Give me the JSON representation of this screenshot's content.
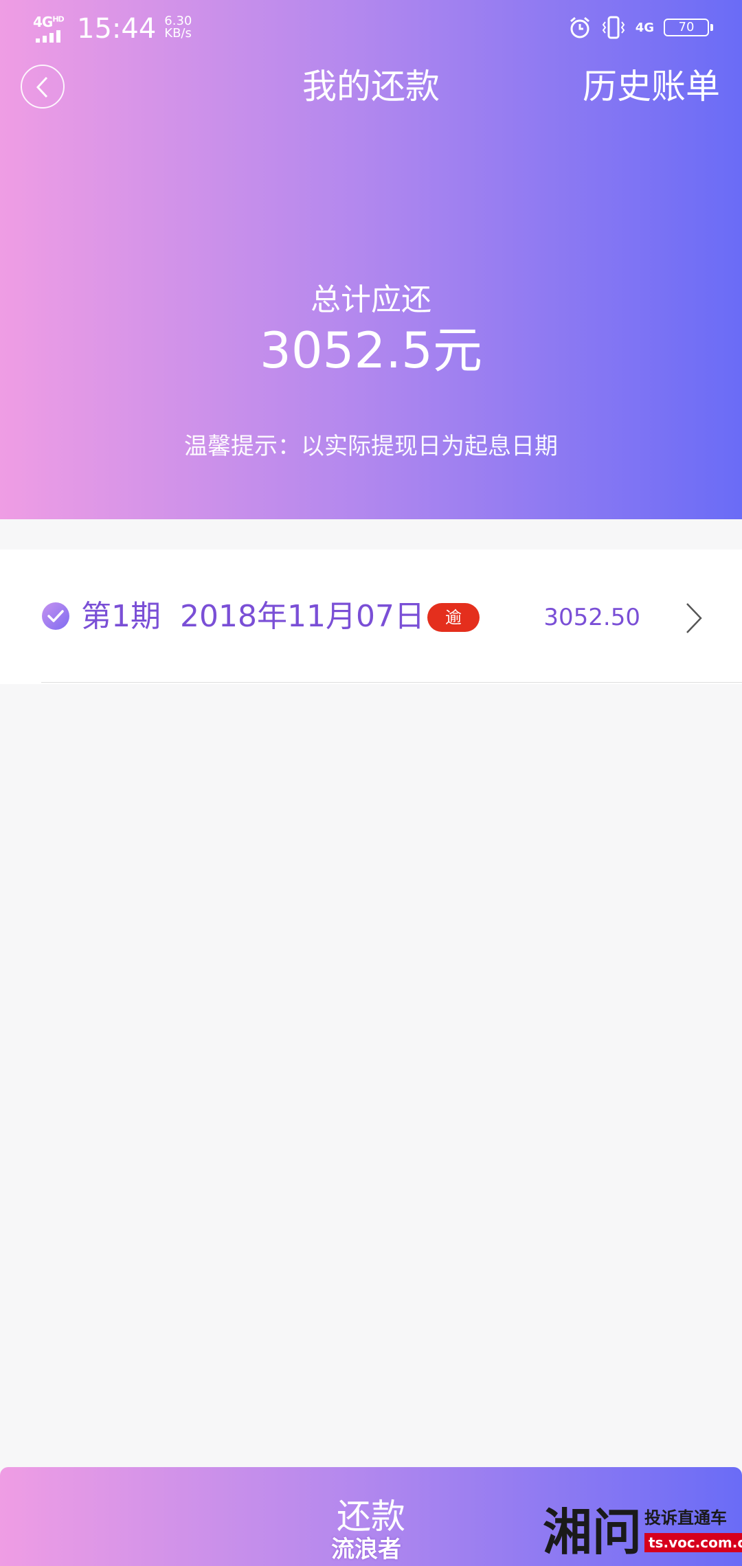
{
  "status_bar": {
    "network": "4G",
    "network_hd": "HD",
    "time": "15:44",
    "speed_value": "6.30",
    "speed_unit": "KB/s",
    "network_right": "4G",
    "battery": "70"
  },
  "header": {
    "title": "我的还款",
    "history_label": "历史账单"
  },
  "summary": {
    "label": "总计应还",
    "amount": "3052.5元",
    "tip": "温馨提示：以实际提现日为起息日期"
  },
  "list": {
    "items": [
      {
        "period": "第1期",
        "date": "2018年11月07日",
        "badge": "逾",
        "amount": "3052.50"
      }
    ]
  },
  "bottom": {
    "button_label": "还款"
  },
  "watermark": {
    "user": "流浪者",
    "logo": "湘问",
    "slogan": "投诉直通车",
    "url": "ts.voc.com.cn"
  },
  "colors": {
    "gradient_start": "#ef9de4",
    "gradient_end": "#6a6cf6",
    "accent_text": "#7a4fd6",
    "badge": "#e42f1d"
  },
  "icons": {
    "back": "chevron-left-icon",
    "check": "check-circle-icon",
    "chevron": "chevron-right-icon"
  }
}
